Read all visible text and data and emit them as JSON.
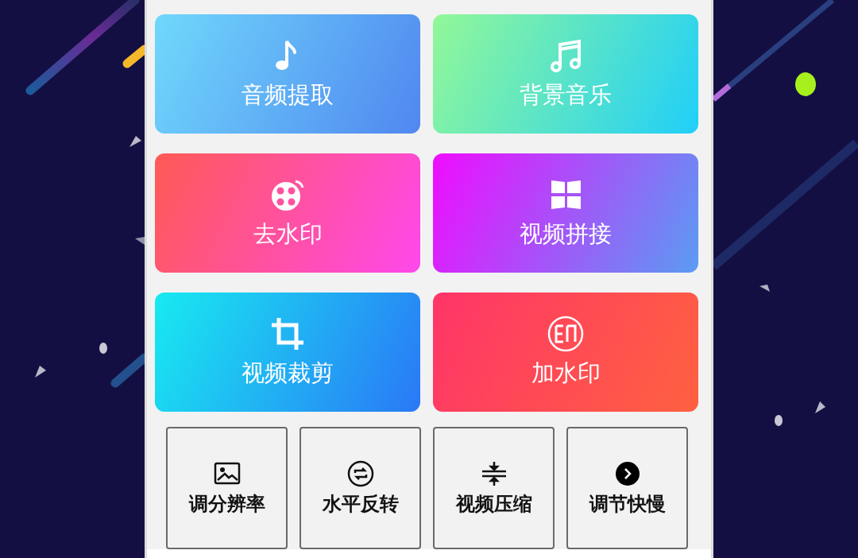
{
  "feature_cards": [
    {
      "label": "音频提取",
      "kind": "note",
      "color": "#70d8fb"
    },
    {
      "label": "背景音乐",
      "kind": "notes",
      "color": "#92f898"
    },
    {
      "label": "去水印",
      "kind": "reel",
      "color": "#ff5a55"
    },
    {
      "label": "视频拼接",
      "kind": "tiles",
      "color": "#f00cff"
    },
    {
      "label": "视频裁剪",
      "kind": "crop",
      "color": "#18eaf0"
    },
    {
      "label": "加水印",
      "kind": "stamp",
      "color": "#ff3568"
    }
  ],
  "tools": [
    {
      "label": "调分辨率",
      "kind": "image"
    },
    {
      "label": "水平反转",
      "kind": "flip"
    },
    {
      "label": "视频压缩",
      "kind": "compress"
    },
    {
      "label": "调节快慢",
      "kind": "speed"
    }
  ]
}
